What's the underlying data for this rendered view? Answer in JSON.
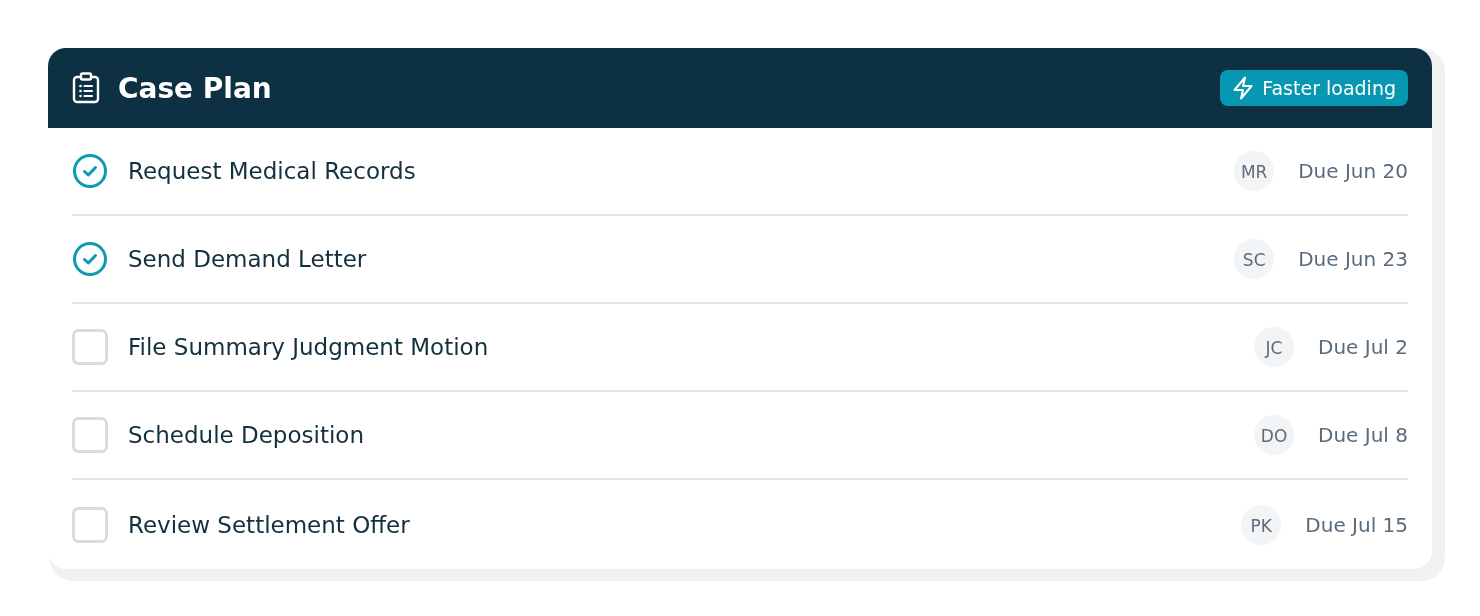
{
  "card": {
    "title": "Case Plan",
    "badge": {
      "label": "Faster loading"
    }
  },
  "tasks": [
    {
      "title": "Request Medical Records",
      "checked": true,
      "assignee": "MR",
      "due": "Due Jun 20"
    },
    {
      "title": "Send Demand Letter",
      "checked": true,
      "assignee": "SC",
      "due": "Due Jun 23"
    },
    {
      "title": "File Summary Judgment Motion",
      "checked": false,
      "assignee": "JC",
      "due": "Due Jul 2"
    },
    {
      "title": "Schedule Deposition",
      "checked": false,
      "assignee": "DO",
      "due": "Due Jul 8"
    },
    {
      "title": "Review Settlement Offer",
      "checked": false,
      "assignee": "PK",
      "due": "Due Jul 15"
    }
  ]
}
